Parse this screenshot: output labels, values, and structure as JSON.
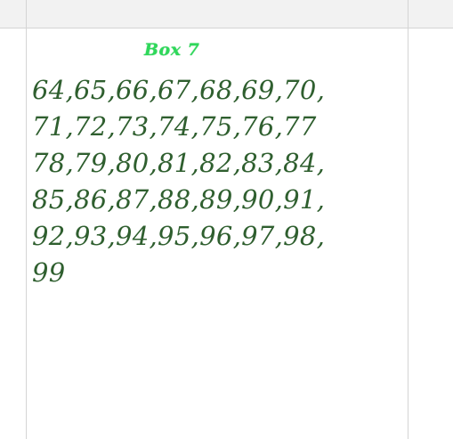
{
  "note_cell": {
    "title": "Box 7",
    "lines": [
      "64,65,66,67,68,69,70,",
      "71,72,73,74,75,76,77",
      "78,79,80,81,82,83,84,",
      "85,86,87,88,89,90,91,",
      "92,93,94,95,96,97,98,",
      "99"
    ]
  },
  "colors": {
    "title": "#2ed85a",
    "handwriting": "#2f5f2f",
    "header_background": "#f2f2f2",
    "grid_lines": "#d4d4d4"
  }
}
